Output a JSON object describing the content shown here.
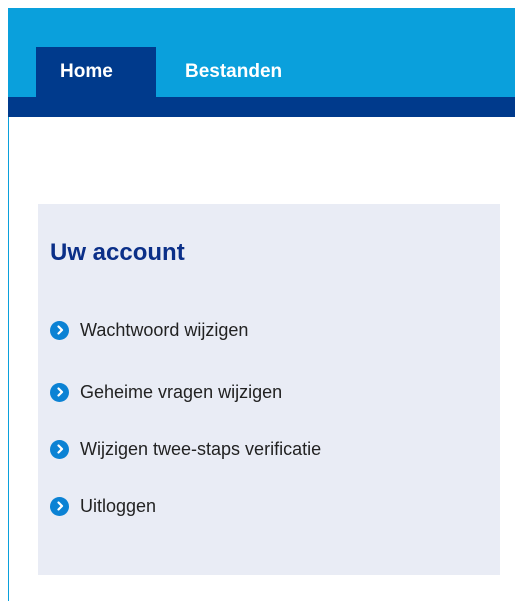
{
  "nav": {
    "tabs": [
      {
        "label": "Home",
        "active": true
      },
      {
        "label": "Bestanden",
        "active": false
      }
    ]
  },
  "account_panel": {
    "title": "Uw account",
    "items": [
      {
        "label": "Wachtwoord wijzigen",
        "icon": "chevron-right-circle-icon"
      },
      {
        "label": "Geheime vragen wijzigen",
        "icon": "chevron-right-circle-icon"
      },
      {
        "label": "Wijzigen twee-staps verificatie",
        "icon": "chevron-right-circle-icon"
      },
      {
        "label": "Uitloggen",
        "icon": "chevron-right-circle-icon"
      }
    ]
  },
  "colors": {
    "header": "#0aa0dc",
    "nav_bar": "#003a8c",
    "panel_bg": "#e9ecf5",
    "title": "#0b2f88",
    "icon": "#0b82d4"
  }
}
